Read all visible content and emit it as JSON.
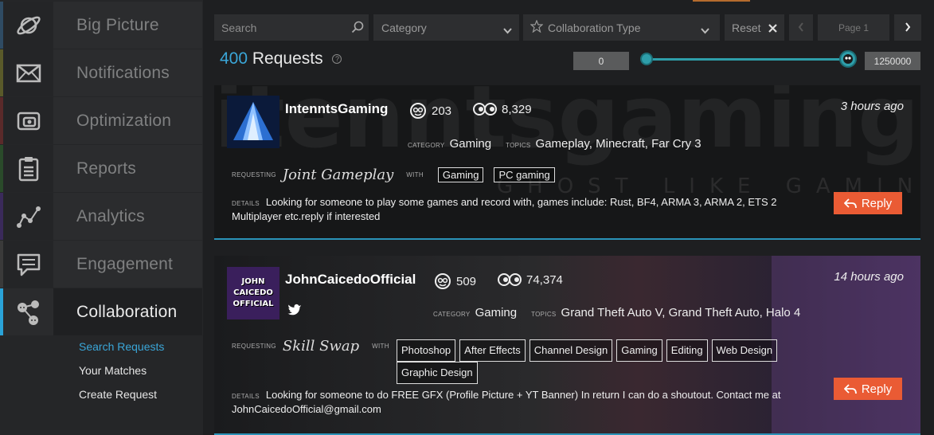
{
  "sidebar": {
    "items": [
      {
        "label": "Big Picture",
        "icon": "planet-icon",
        "stripe": "#2f4b63"
      },
      {
        "label": "Notifications",
        "icon": "envelope-icon",
        "stripe": "#5a5a2a"
      },
      {
        "label": "Optimization",
        "icon": "camera-icon",
        "stripe": "#5a2a2a"
      },
      {
        "label": "Reports",
        "icon": "clipboard-icon",
        "stripe": "#2a4a2a"
      },
      {
        "label": "Analytics",
        "icon": "scatter-chart-icon",
        "stripe": "#3a2a5a"
      },
      {
        "label": "Engagement",
        "icon": "chat-icon",
        "stripe": "#3a3a3a"
      },
      {
        "label": "Collaboration",
        "icon": "people-network-icon",
        "stripe": "#2aa3d8"
      }
    ],
    "sub_items": [
      "Search Requests",
      "Your Matches",
      "Create Request"
    ]
  },
  "toolbar": {
    "search_placeholder": "Search",
    "category_label": "Category",
    "collab_type_label": "Collaboration Type",
    "reset_label": "Reset",
    "page_label": "Page 1"
  },
  "summary": {
    "count": "400",
    "label": "Requests"
  },
  "range": {
    "min": "0",
    "max": "1250000"
  },
  "labels": {
    "category": "CATEGORY",
    "topics": "TOPICS",
    "requesting": "REQUESTING",
    "with": "WITH",
    "details": "DETAILS",
    "reply": "Reply"
  },
  "requests": [
    {
      "name": "IntenntsGaming",
      "subscribers": "203",
      "views": "8,329",
      "time": "3 hours ago",
      "category": "Gaming",
      "topics": "Gameplay, Minecraft, Far Cry 3",
      "requesting": "Joint Gameplay",
      "tags": [
        "Gaming",
        "PC gaming"
      ],
      "details": "Looking for someone to play some games and record with, games include: Rust, BF4, ARMA 3, ARMA 2, ETS 2 Multiplayer etc.reply if interested",
      "bg_text": "itenntsgaming",
      "bg_sub": "GHOST LIKE GAMING"
    },
    {
      "name": "JohnCaicedoOfficial",
      "subscribers": "509",
      "views": "74,374",
      "time": "14 hours ago",
      "category": "Gaming",
      "topics": "Grand Theft Auto V, Grand Theft Auto, Halo 4",
      "requesting": "Skill Swap",
      "tags": [
        "Photoshop",
        "After Effects",
        "Channel Design",
        "Gaming",
        "Editing",
        "Web Design",
        "Graphic Design"
      ],
      "details": "Looking for someone to do FREE GFX (Profile Picture + YT Banner) In return I can do a shoutout. Contact me at JohnCaicedoOfficial@gmail.com",
      "avatar_text": [
        "JOHN",
        "CAICEDO",
        "OFFICIAL"
      ]
    }
  ]
}
